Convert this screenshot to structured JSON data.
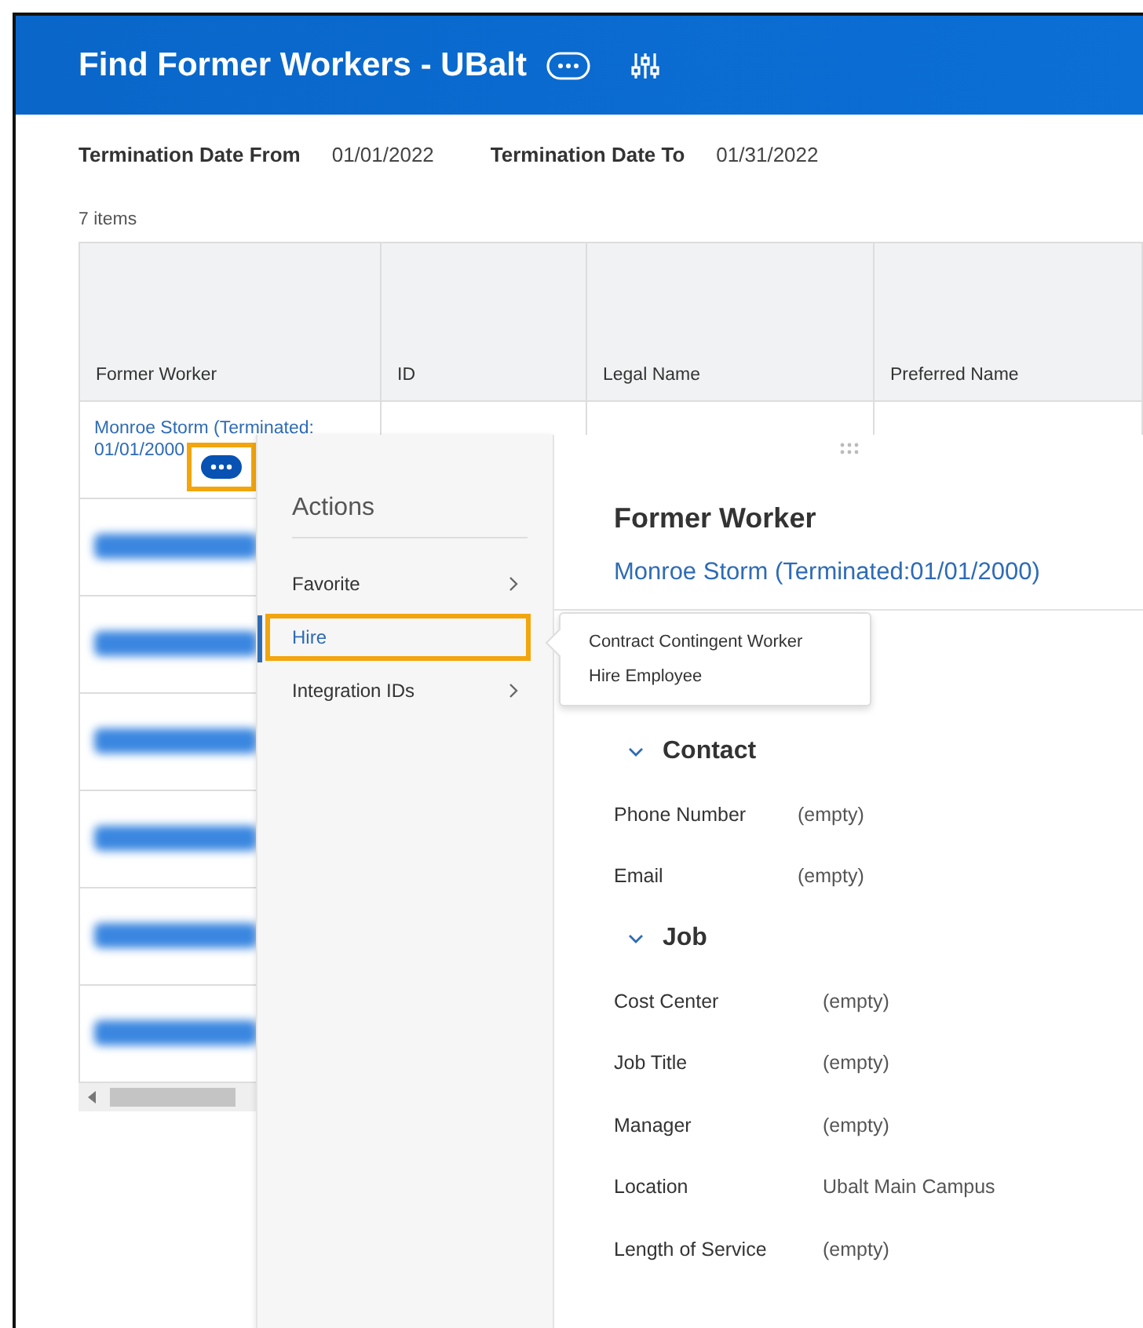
{
  "header": {
    "title": "Find Former Workers - UBalt"
  },
  "filters": [
    {
      "label": "Termination Date From",
      "value": "01/01/2022"
    },
    {
      "label": "Termination Date To",
      "value": "01/31/2022"
    }
  ],
  "item_count": "7 items",
  "table": {
    "columns": [
      "Former Worker",
      "ID",
      "Legal Name",
      "Preferred Name"
    ],
    "rows": [
      {
        "former_worker": "Monroe Storm (Terminated:01/01/2000",
        "redacted": false,
        "highlighted": true
      },
      {
        "redacted": true
      },
      {
        "redacted": true
      },
      {
        "redacted": true
      },
      {
        "redacted": true
      },
      {
        "redacted": true
      },
      {
        "redacted": true
      }
    ]
  },
  "actions_menu": {
    "title": "Actions",
    "items": [
      {
        "label": "Favorite",
        "selected": false,
        "has_submenu": true,
        "highlighted": false
      },
      {
        "label": "Hire",
        "selected": true,
        "has_submenu": false,
        "highlighted": true
      },
      {
        "label": "Integration IDs",
        "selected": false,
        "has_submenu": true,
        "highlighted": false
      }
    ]
  },
  "submenu": {
    "items": [
      "Contract Contingent Worker",
      "Hire Employee"
    ]
  },
  "detail": {
    "title": "Former Worker",
    "worker_link": "Monroe Storm (Terminated:01/01/2000)",
    "sections": [
      {
        "title": "Contact",
        "expanded": true,
        "fields": [
          {
            "label": "Phone Number",
            "value": "(empty)"
          },
          {
            "label": "Email",
            "value": "(empty)"
          }
        ]
      },
      {
        "title": "Job",
        "expanded": true,
        "fields": [
          {
            "label": "Cost Center",
            "value": "(empty)"
          },
          {
            "label": "Job Title",
            "value": "(empty)"
          },
          {
            "label": "Manager",
            "value": "(empty)"
          },
          {
            "label": "Location",
            "value": "Ubalt Main Campus"
          },
          {
            "label": "Length of Service",
            "value": "(empty)"
          }
        ]
      }
    ]
  }
}
